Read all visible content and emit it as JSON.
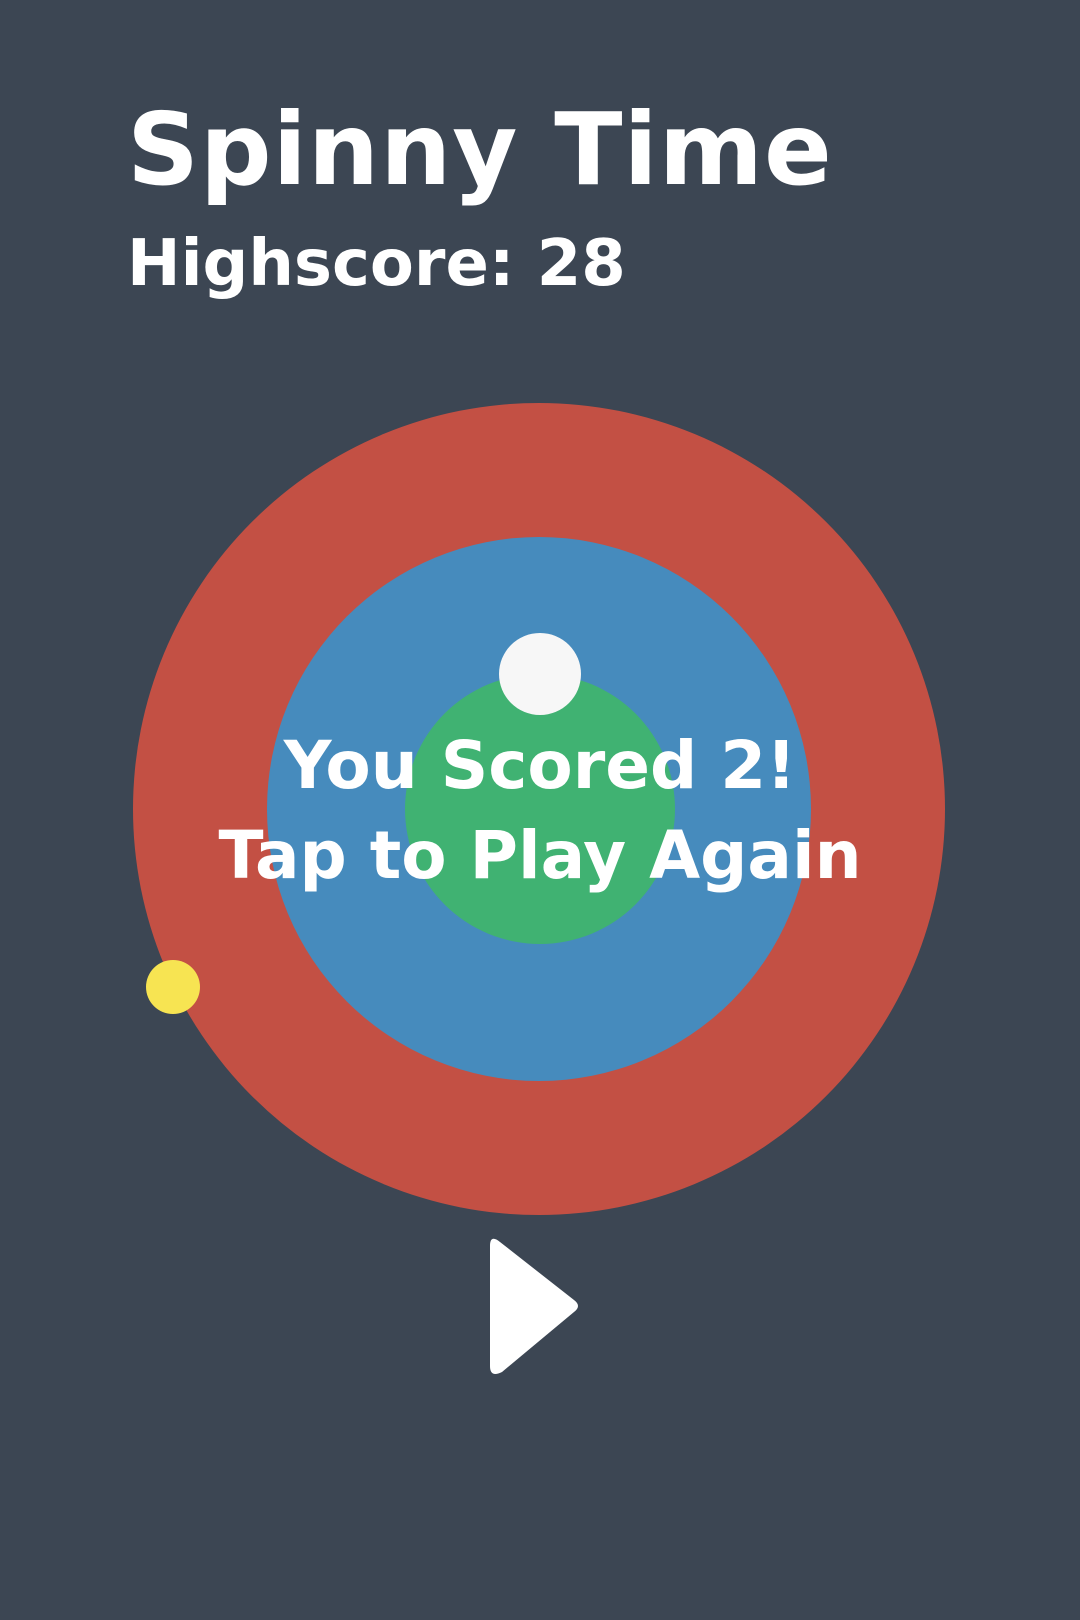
{
  "header": {
    "title": "Spinny Time",
    "highscore_label": "Highscore: 28"
  },
  "game": {
    "score_message": "You Scored 2!",
    "prompt": "Tap to Play Again",
    "colors": {
      "background": "#3c4653",
      "outer_ring": "#c35044",
      "middle_ring": "#468bbd",
      "inner_circle": "#40b272",
      "white_ball": "#f7f7f7",
      "yellow_ball": "#f7e452"
    }
  },
  "controls": {
    "play_icon": "play-icon"
  }
}
